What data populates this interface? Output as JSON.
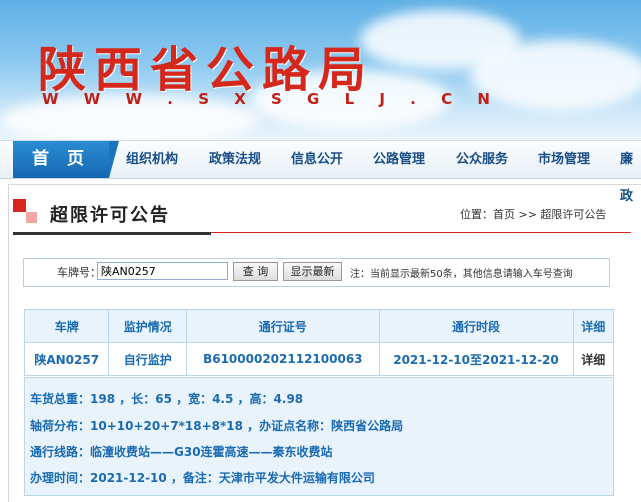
{
  "site": {
    "title": "陕西省公路局",
    "url": "W W W . S X S G L J . C N"
  },
  "nav": {
    "home": "首 页",
    "items": [
      "组织机构",
      "政策法规",
      "信息公开",
      "公路管理",
      "公众服务",
      "市场管理",
      "廉政"
    ]
  },
  "section": {
    "title": "超限许可公告",
    "breadcrumb": "位置：首页 >> 超限许可公告"
  },
  "search": {
    "label": "车牌号：",
    "value": "陕AN0257",
    "query_button": "查 询",
    "latest_button": "显示最新",
    "note": "注：当前显示最新50条，其他信息请输入车号查询"
  },
  "table": {
    "headers": [
      "车牌",
      "监护情况",
      "通行证号",
      "通行时段",
      "详细"
    ],
    "row": [
      "陕AN0257",
      "自行监护",
      "B610000202112100063",
      "2021-12-10至2021-12-20",
      "详细"
    ]
  },
  "details": {
    "line1": "车货总重：198 ，长：65 ，宽：4.5 ，高：4.98",
    "line2": "轴荷分布：10+10+20+7*18+8*18 ，办证点名称：陕西省公路局",
    "line3": "通行线路：临潼收费站——G30连霍高速——秦东收费站",
    "line4": "办理时间：2021-12-10 ，备注：天津市平发大件运输有限公司"
  }
}
